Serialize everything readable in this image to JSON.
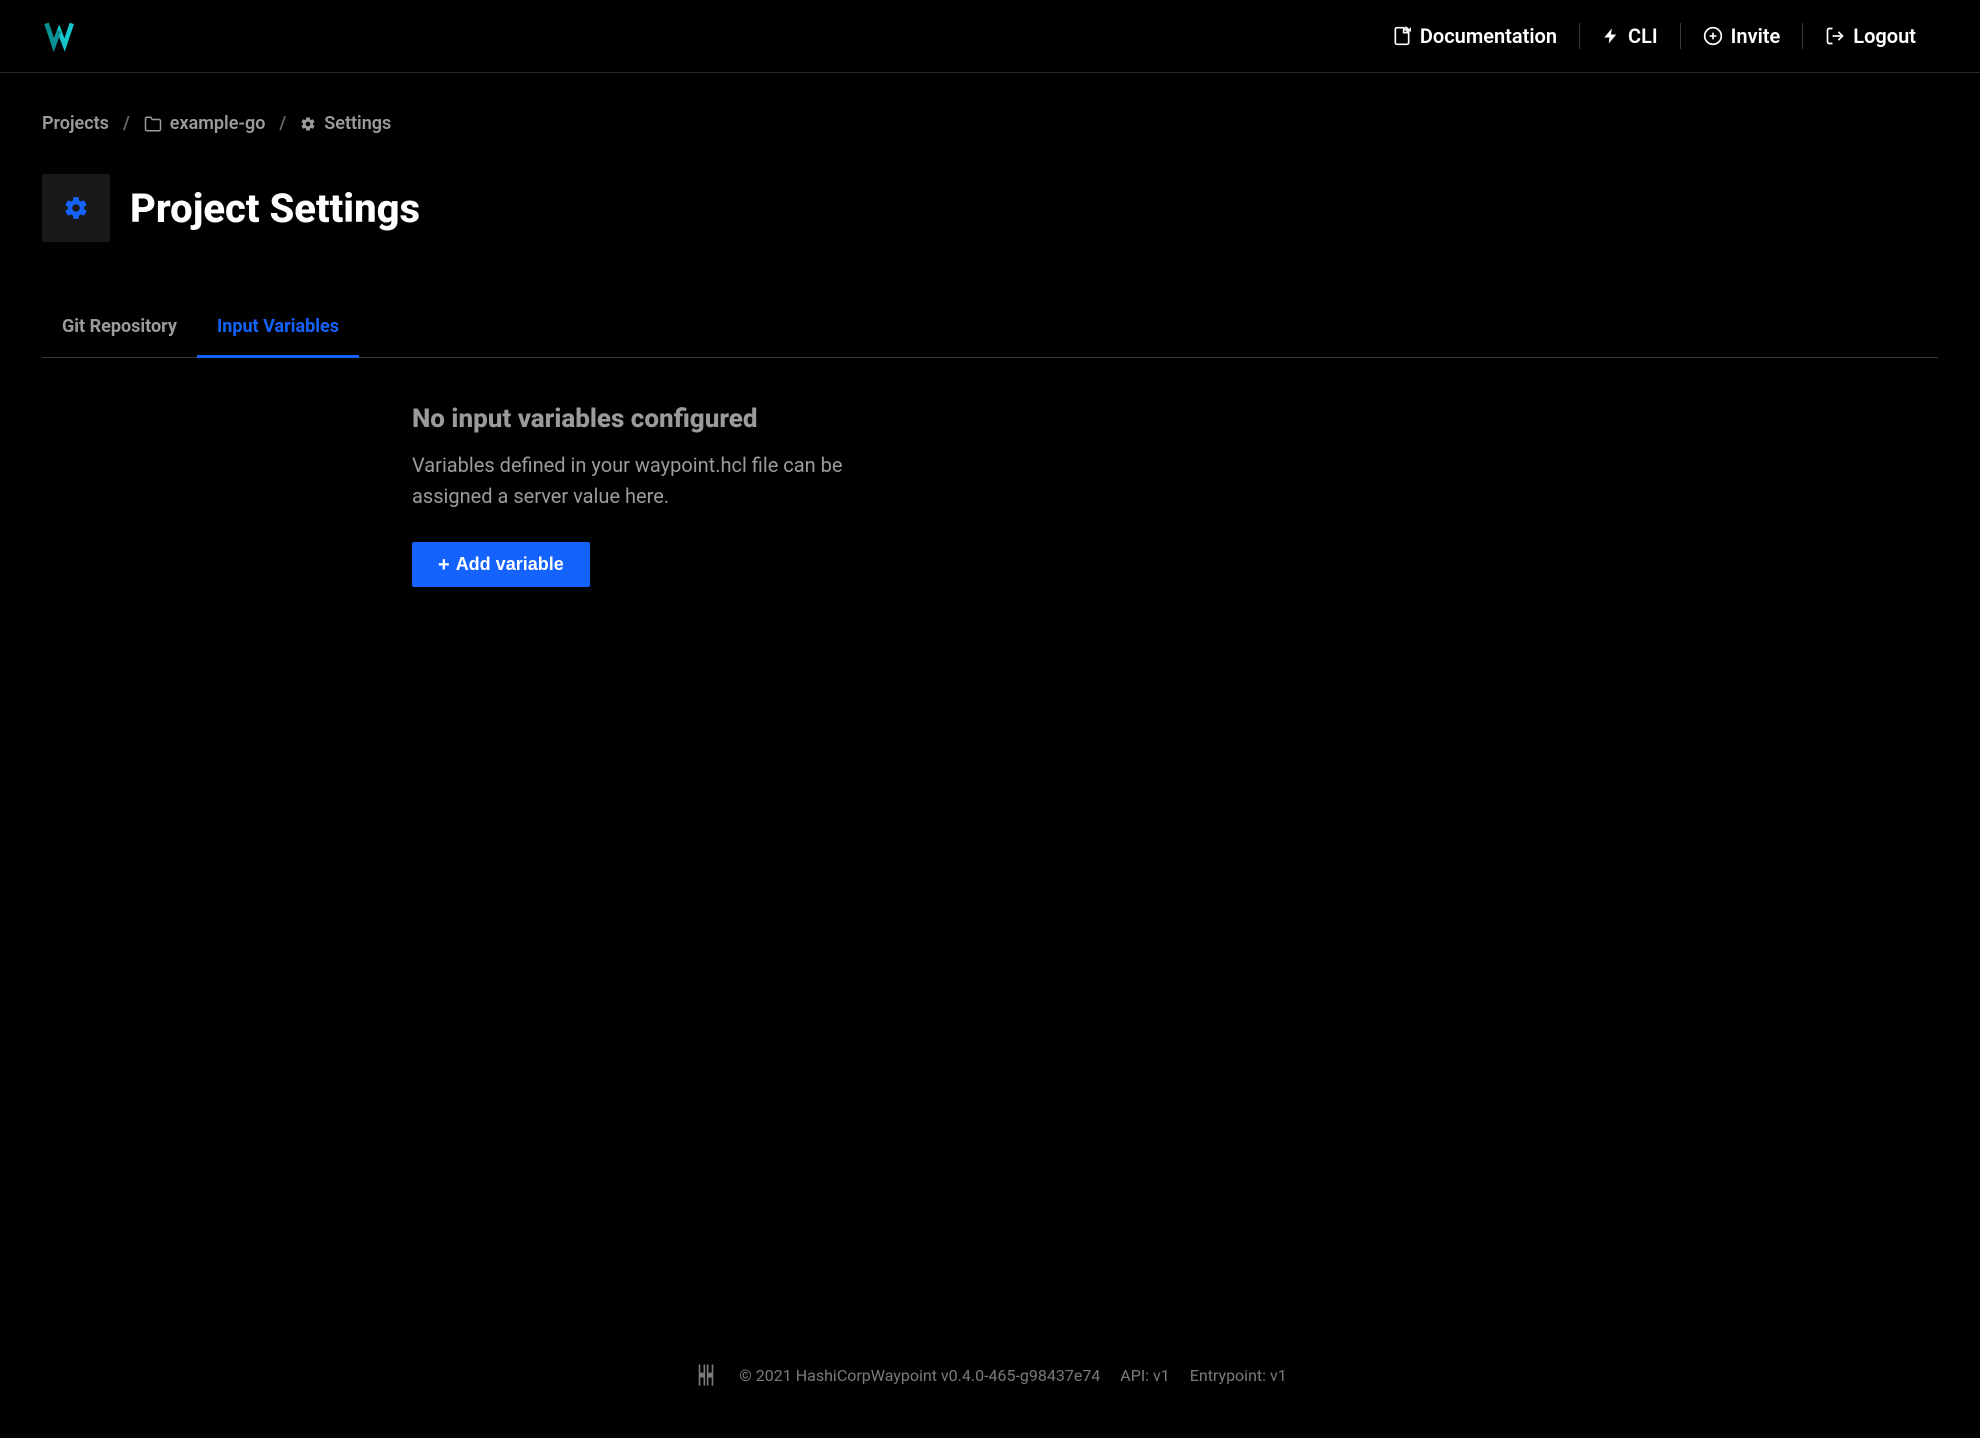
{
  "header": {
    "nav": {
      "documentation": "Documentation",
      "cli": "CLI",
      "invite": "Invite",
      "logout": "Logout"
    }
  },
  "breadcrumb": {
    "projects": "Projects",
    "project_name": "example-go",
    "settings": "Settings"
  },
  "page": {
    "title": "Project Settings"
  },
  "tabs": {
    "git": "Git Repository",
    "input_vars": "Input Variables"
  },
  "empty_state": {
    "heading": "No input variables configured",
    "description": "Variables defined in your waypoint.hcl file can be assigned a server value here.",
    "button": "Add variable"
  },
  "footer": {
    "copyright": "© 2021 HashiCorp",
    "version": "Waypoint v0.4.0-465-g98437e74",
    "api": "API: v1",
    "entrypoint": "Entrypoint: v1"
  }
}
